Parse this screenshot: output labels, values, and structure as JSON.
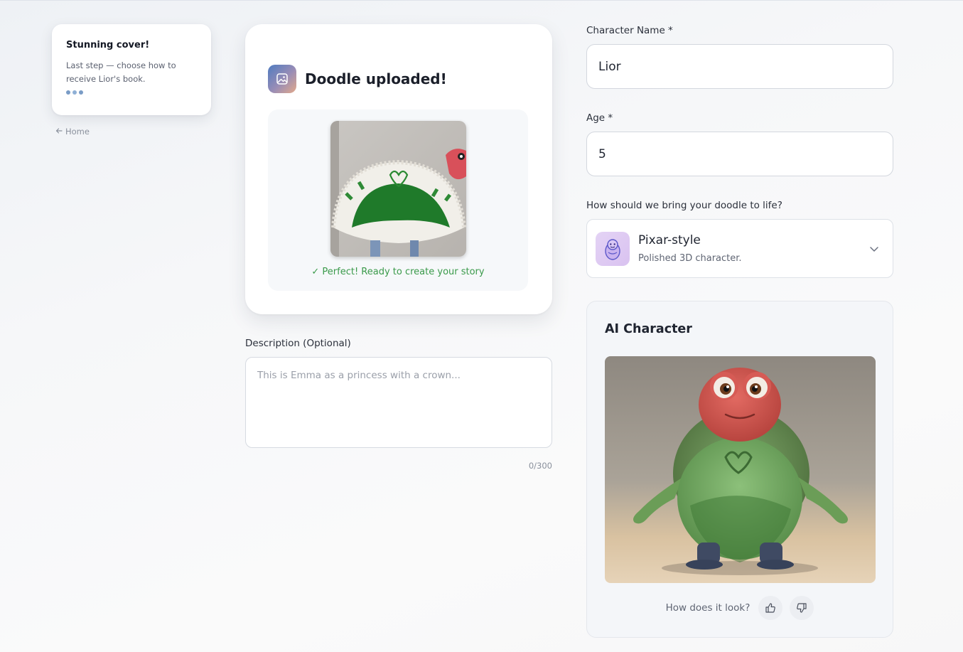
{
  "toast": {
    "title": "Stunning cover!",
    "body": "Last step — choose how to receive Lior's book."
  },
  "nav": {
    "home_label": "Home"
  },
  "upload": {
    "title": "Doodle uploaded!",
    "success_text": "✓ Perfect! Ready to create your story"
  },
  "description": {
    "label": "Description (Optional)",
    "placeholder": "This is Emma as a princess with a crown...",
    "value": "",
    "counter": "0/300"
  },
  "form": {
    "name_label": "Character Name *",
    "name_value": "Lior",
    "age_label": "Age *",
    "age_value": "5",
    "style_question": "How should we bring your doodle to life?",
    "style_selected": {
      "name": "Pixar-style",
      "desc": "Polished 3D character."
    }
  },
  "ai_character": {
    "title": "AI Character",
    "feedback_question": "How does it look?"
  },
  "colors": {
    "accent_green": "#3a9a4a",
    "dot_blue": "#7a9cc6",
    "style_thumb": "#e4d3f5"
  },
  "icons": [
    "image-icon",
    "arrow-left-icon",
    "chevron-down-icon",
    "thumbs-up-icon",
    "thumbs-down-icon",
    "character-face-icon"
  ]
}
